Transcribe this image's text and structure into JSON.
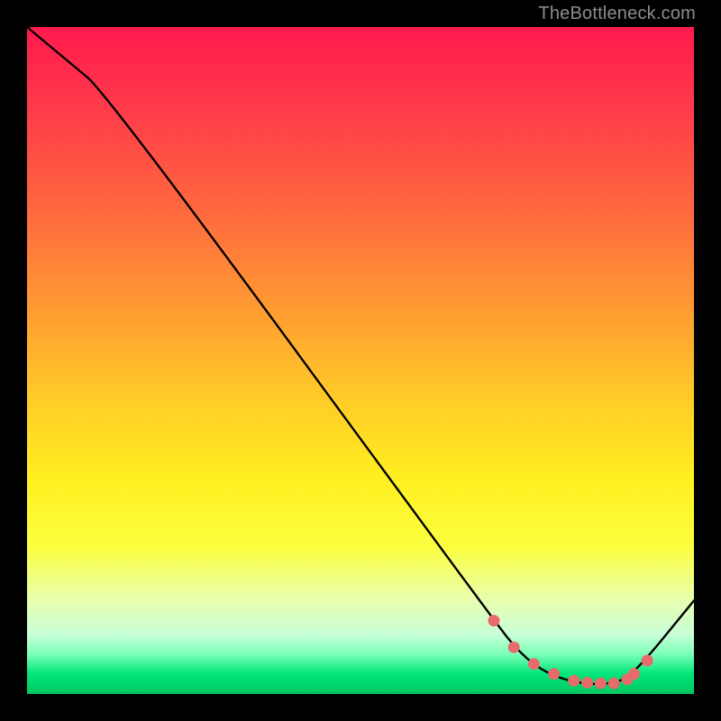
{
  "watermark": "TheBottleneck.com",
  "chart_data": {
    "type": "line",
    "title": "",
    "xlabel": "",
    "ylabel": "",
    "xlim": [
      0,
      100
    ],
    "ylim": [
      0,
      100
    ],
    "grid": false,
    "series": [
      {
        "name": "curve",
        "x": [
          0,
          6,
          12,
          70,
          74,
          78,
          83,
          88,
          91,
          100
        ],
        "y": [
          100,
          95,
          90,
          11,
          6,
          3,
          1.5,
          1.5,
          3,
          14
        ]
      }
    ],
    "markers": {
      "name": "highlight-points",
      "color": "#e86b6b",
      "x": [
        70,
        73,
        76,
        79,
        82,
        84,
        86,
        88,
        90,
        91,
        93
      ],
      "y": [
        11,
        7,
        4.5,
        3,
        2,
        1.7,
        1.6,
        1.6,
        2.2,
        3,
        5
      ]
    }
  }
}
